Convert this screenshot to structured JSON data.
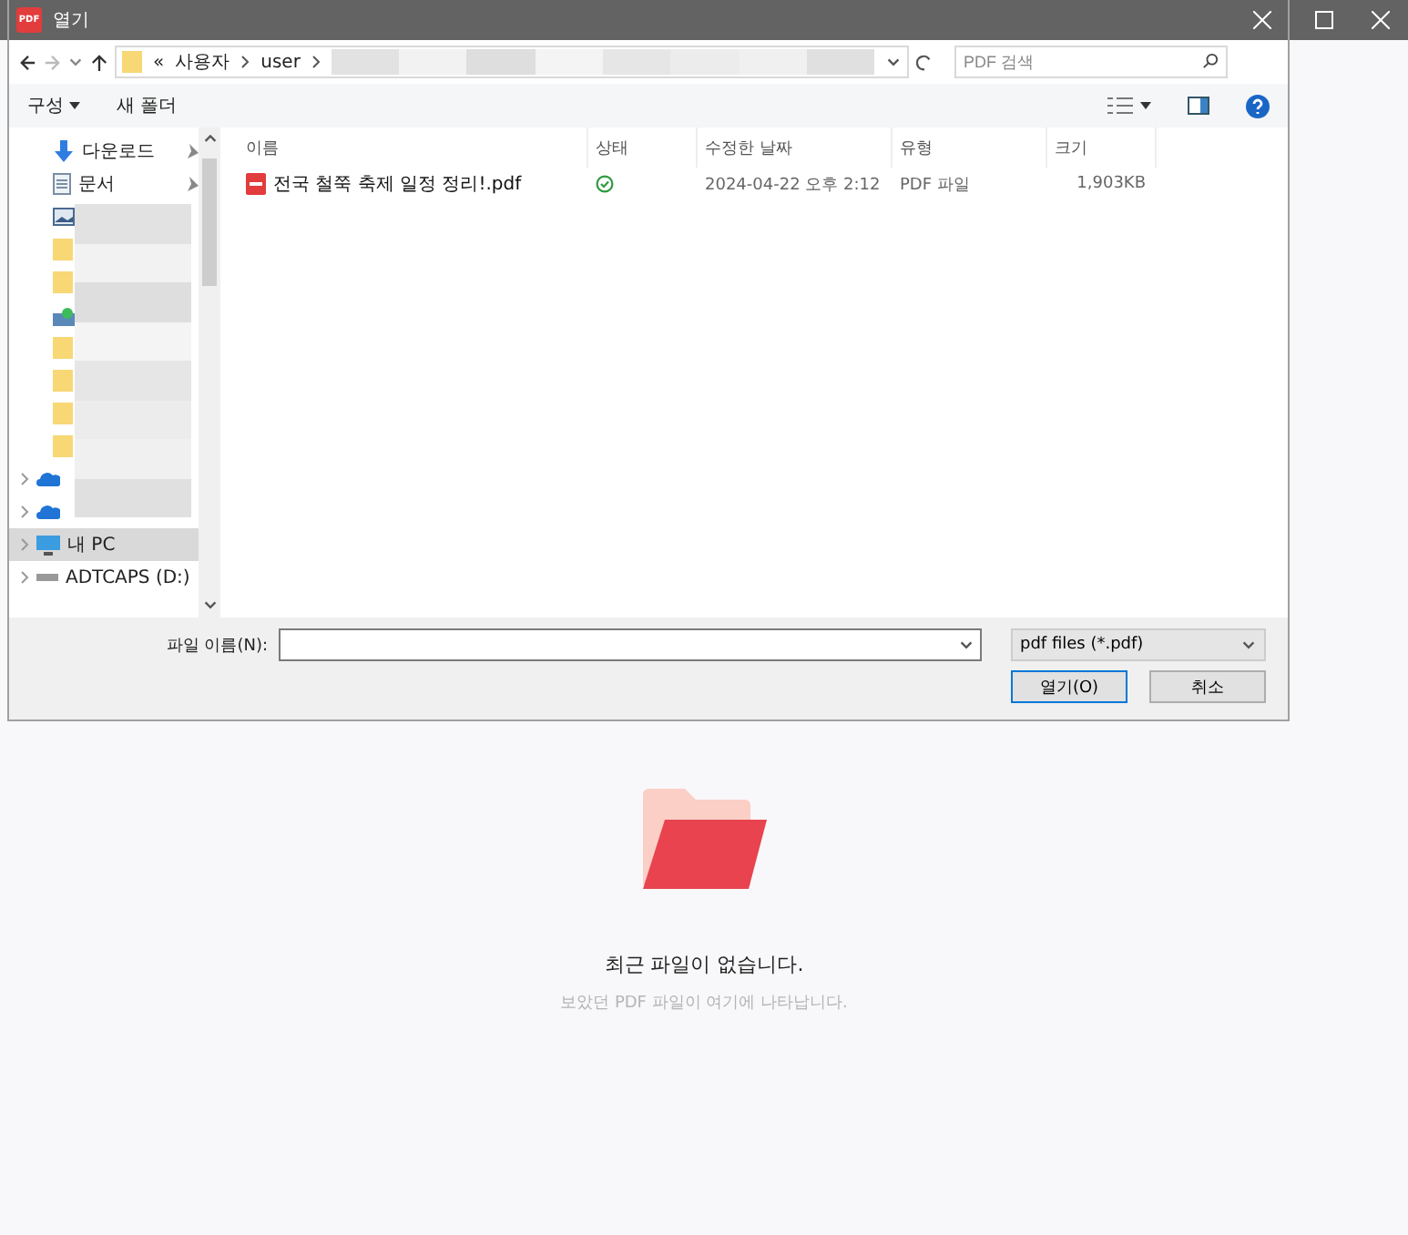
{
  "app": {
    "empty_state": {
      "title": "최근 파일이 없습니다.",
      "subtitle": "보았던 PDF 파일이 여기에 나타납니다."
    }
  },
  "dialog": {
    "title": "열기",
    "app_badge": "PDF",
    "breadcrumb": [
      "«",
      "사용자",
      "user"
    ],
    "search": {
      "placeholder": "PDF 검색"
    },
    "toolbar": [
      "구성",
      "새 폴더"
    ],
    "sidebar": [
      {
        "kind": "download",
        "label": "다운로드",
        "pinned": true,
        "selected": false
      },
      {
        "kind": "document",
        "label": "문서",
        "pinned": true,
        "selected": false
      },
      {
        "kind": "picture",
        "pinned": false,
        "selected": false
      },
      {
        "kind": "folder",
        "pinned": false,
        "selected": false
      },
      {
        "kind": "folder",
        "pinned": false,
        "selected": false
      },
      {
        "kind": "share",
        "pinned": false,
        "selected": false
      },
      {
        "kind": "folder",
        "pinned": false,
        "selected": false
      },
      {
        "kind": "folder",
        "pinned": false,
        "selected": false
      },
      {
        "kind": "folder",
        "pinned": false,
        "selected": false
      },
      {
        "kind": "folder",
        "pinned": false,
        "selected": false
      },
      {
        "kind": "cloud",
        "pinned": false,
        "selected": false
      },
      {
        "kind": "cloud",
        "pinned": false,
        "selected": false
      },
      {
        "kind": "pc",
        "label": "내 PC",
        "pinned": false,
        "selected": true
      },
      {
        "kind": "drive",
        "label": "ADTCAPS (D:)",
        "pinned": false,
        "selected": false
      }
    ],
    "columns": [
      "이름",
      "상태",
      "수정한 날짜",
      "유형",
      "크기"
    ],
    "files": [
      {
        "name": "전국 철쭉 축제 일정 정리!.pdf",
        "modified": "2024-04-22 오후 2:12",
        "type": "PDF 파일",
        "size": "1,903KB"
      }
    ],
    "filename_label": "파일 이름(N):",
    "filetype": "pdf files (*.pdf)",
    "buttons": [
      "열기(O)",
      "취소"
    ]
  }
}
